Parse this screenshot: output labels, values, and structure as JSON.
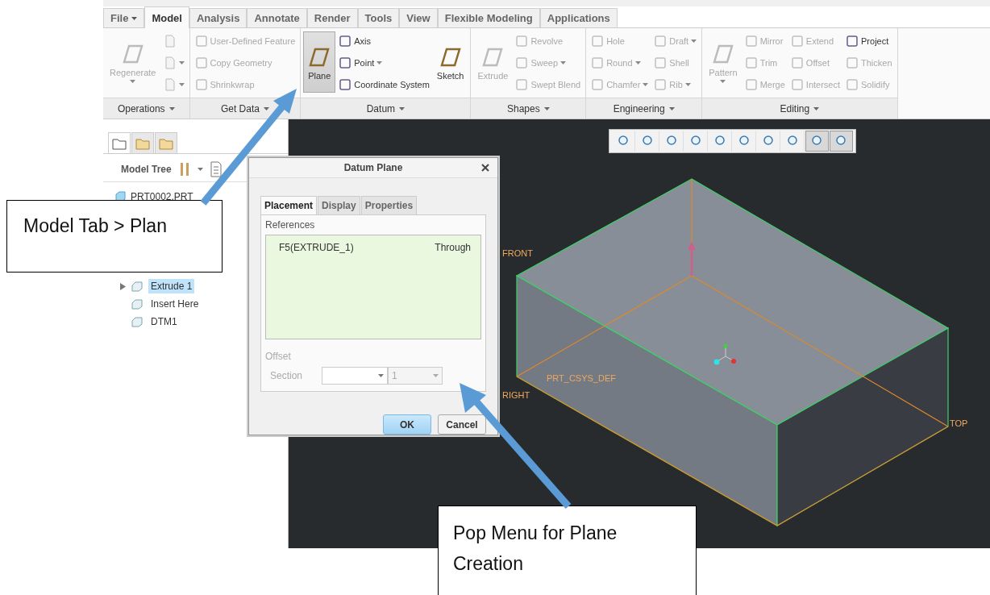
{
  "ribbon_tabs": [
    {
      "label": "File",
      "dropdown": true,
      "selected": false
    },
    {
      "label": "Model",
      "selected": true
    },
    {
      "label": "Analysis",
      "selected": false
    },
    {
      "label": "Annotate",
      "selected": false
    },
    {
      "label": "Render",
      "selected": false
    },
    {
      "label": "Tools",
      "selected": false
    },
    {
      "label": "View",
      "selected": false
    },
    {
      "label": "Flexible Modeling",
      "selected": false
    },
    {
      "label": "Applications",
      "selected": false
    }
  ],
  "ribbon_groups": [
    {
      "label": "Operations",
      "columns": [
        [
          {
            "kind": "large",
            "label": "Regenerate",
            "dropdown": true,
            "disabled": true
          }
        ],
        [
          {
            "kind": "icon",
            "disabled": true
          },
          {
            "kind": "icon",
            "dropdown": true,
            "disabled": true
          },
          {
            "kind": "icon",
            "dropdown": true,
            "disabled": true
          }
        ]
      ]
    },
    {
      "label": "Get Data",
      "columns": [
        [
          {
            "kind": "small",
            "label": "User-Defined Feature",
            "disabled": true
          },
          {
            "kind": "small",
            "label": "Copy Geometry",
            "disabled": true
          },
          {
            "kind": "small",
            "label": "Shrinkwrap",
            "disabled": true
          }
        ]
      ]
    },
    {
      "label": "Datum",
      "columns": [
        [
          {
            "kind": "large",
            "label": "Plane",
            "disabled": false,
            "pressed": true
          }
        ],
        [
          {
            "kind": "small",
            "label": "Axis",
            "disabled": false
          },
          {
            "kind": "small",
            "label": "Point",
            "dropdown": true,
            "disabled": false
          },
          {
            "kind": "small",
            "label": "Coordinate System",
            "disabled": false
          }
        ],
        [
          {
            "kind": "large",
            "label": "Sketch",
            "disabled": false
          }
        ]
      ]
    },
    {
      "label": "Shapes",
      "columns": [
        [
          {
            "kind": "large",
            "label": "Extrude",
            "disabled": true
          }
        ],
        [
          {
            "kind": "small",
            "label": "Revolve",
            "disabled": true
          },
          {
            "kind": "small",
            "label": "Sweep",
            "dropdown": true,
            "disabled": true
          },
          {
            "kind": "small",
            "label": "Swept Blend",
            "disabled": true
          }
        ]
      ]
    },
    {
      "label": "Engineering",
      "columns": [
        [
          {
            "kind": "small",
            "label": "Hole",
            "disabled": true
          },
          {
            "kind": "small",
            "label": "Round",
            "dropdown": true,
            "disabled": true
          },
          {
            "kind": "small",
            "label": "Chamfer",
            "dropdown": true,
            "disabled": true
          }
        ],
        [
          {
            "kind": "small",
            "label": "Draft",
            "dropdown": true,
            "disabled": true
          },
          {
            "kind": "small",
            "label": "Shell",
            "disabled": true
          },
          {
            "kind": "small",
            "label": "Rib",
            "dropdown": true,
            "disabled": true
          }
        ]
      ]
    },
    {
      "label": "Editing",
      "columns": [
        [
          {
            "kind": "large",
            "label": "Pattern",
            "dropdown": true,
            "disabled": true
          }
        ],
        [
          {
            "kind": "small",
            "label": "Mirror",
            "disabled": true
          },
          {
            "kind": "small",
            "label": "Trim",
            "disabled": true
          },
          {
            "kind": "small",
            "label": "Merge",
            "disabled": true
          }
        ],
        [
          {
            "kind": "small",
            "label": "Extend",
            "disabled": true
          },
          {
            "kind": "small",
            "label": "Offset",
            "disabled": true
          },
          {
            "kind": "small",
            "label": "Intersect",
            "disabled": true
          }
        ],
        [
          {
            "kind": "small",
            "label": "Project",
            "disabled": false
          },
          {
            "kind": "small",
            "label": "Thicken",
            "disabled": true
          },
          {
            "kind": "small",
            "label": "Solidify",
            "disabled": true
          }
        ]
      ]
    }
  ],
  "navigator_tabs": [
    {
      "selected": true
    },
    {
      "selected": false
    },
    {
      "selected": false
    }
  ],
  "model_tree": {
    "title": "Model Tree",
    "root": {
      "label": "PRT0002.PRT",
      "children": [
        {
          "label": "Extrude 1",
          "expanded": false,
          "selected": true
        },
        {
          "label": "Insert Here",
          "selected": false
        },
        {
          "label": "DTM1",
          "selected": false
        }
      ]
    }
  },
  "view_toolbar": [
    {
      "pressed": false
    },
    {
      "pressed": false
    },
    {
      "pressed": false
    },
    {
      "pressed": false
    },
    {
      "pressed": false
    },
    {
      "pressed": false
    },
    {
      "pressed": false
    },
    {
      "pressed": false
    },
    {
      "pressed": true
    },
    {
      "pressed": true
    }
  ],
  "viewport_labels": {
    "front": "FRONT",
    "csys": "PRT_CSYS_DEF",
    "right": "RIGHT",
    "top": "TOP"
  },
  "dialog": {
    "title": "Datum Plane",
    "tabs": [
      {
        "label": "Placement",
        "selected": true
      },
      {
        "label": "Display",
        "selected": false
      },
      {
        "label": "Properties",
        "selected": false
      }
    ],
    "references_label": "References",
    "references": [
      {
        "name": "F5(EXTRUDE_1)",
        "constraint": "Through"
      }
    ],
    "offset_label": "Offset",
    "offset_disabled": true,
    "section_label": "Section",
    "section_value": "1",
    "buttons": [
      {
        "label": "OK",
        "primary": true
      },
      {
        "label": "Cancel",
        "primary": false
      }
    ]
  },
  "callouts": [
    {
      "text": "Model Tab > Plan"
    },
    {
      "text": "Pop Menu for Plane Creation"
    }
  ]
}
